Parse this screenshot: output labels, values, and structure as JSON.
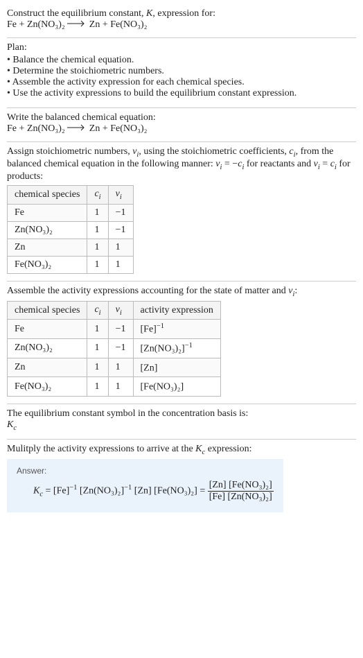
{
  "intro": {
    "line1_prefix": "Construct the equilibrium constant, ",
    "line1_K": "K",
    "line1_suffix": ", expression for:",
    "eqn_lhs": "Fe + Zn(NO₃)₂",
    "eqn_rhs": "Zn + Fe(NO₃)₂"
  },
  "plan": {
    "title": "Plan:",
    "items": [
      "Balance the chemical equation.",
      "Determine the stoichiometric numbers.",
      "Assemble the activity expression for each chemical species.",
      "Use the activity expressions to build the equilibrium constant expression."
    ]
  },
  "balanced": {
    "title": "Write the balanced chemical equation:",
    "eqn_lhs": "Fe + Zn(NO₃)₂",
    "eqn_rhs": "Zn + Fe(NO₃)₂"
  },
  "assign": {
    "text_parts": {
      "p1": "Assign stoichiometric numbers, ",
      "nu": "ν",
      "sub_i": "i",
      "p2": ", using the stoichiometric coefficients, ",
      "c": "c",
      "p3": ", from the balanced chemical equation in the following manner: ",
      "rel1": "ν",
      "rel1b": " = −",
      "rel1c": "c",
      "p4": " for reactants and ",
      "rel2": "ν",
      "rel2b": " = ",
      "rel2c": "c",
      "p5": " for products:"
    },
    "headers": {
      "species": "chemical species",
      "c": "c",
      "nu": "ν",
      "sub": "i"
    },
    "rows": [
      {
        "species": "Fe",
        "c": "1",
        "nu": "−1"
      },
      {
        "species": "Zn(NO₃)₂",
        "c": "1",
        "nu": "−1"
      },
      {
        "species": "Zn",
        "c": "1",
        "nu": "1"
      },
      {
        "species": "Fe(NO₃)₂",
        "c": "1",
        "nu": "1"
      }
    ]
  },
  "activity": {
    "text_prefix": "Assemble the activity expressions accounting for the state of matter and ",
    "nu": "ν",
    "sub_i": "i",
    "text_suffix": ":",
    "headers": {
      "species": "chemical species",
      "c": "c",
      "nu": "ν",
      "sub": "i",
      "act": "activity expression"
    },
    "rows": [
      {
        "species": "Fe",
        "c": "1",
        "nu": "−1",
        "act_base": "[Fe]",
        "act_exp": "−1"
      },
      {
        "species": "Zn(NO₃)₂",
        "c": "1",
        "nu": "−1",
        "act_base": "[Zn(NO₃)₂]",
        "act_exp": "−1"
      },
      {
        "species": "Zn",
        "c": "1",
        "nu": "1",
        "act_base": "[Zn]",
        "act_exp": ""
      },
      {
        "species": "Fe(NO₃)₂",
        "c": "1",
        "nu": "1",
        "act_base": "[Fe(NO₃)₂]",
        "act_exp": ""
      }
    ]
  },
  "basis": {
    "text": "The equilibrium constant symbol in the concentration basis is:",
    "symbol_K": "K",
    "symbol_sub": "c"
  },
  "multiply": {
    "text_prefix": "Mulitply the activity expressions to arrive at the ",
    "K": "K",
    "sub": "c",
    "text_suffix": " expression:"
  },
  "answer": {
    "label": "Answer:",
    "lhs_K": "K",
    "lhs_sub": "c",
    "eq": " = ",
    "term1_base": "[Fe]",
    "term1_exp": "−1",
    "term2_base": "[Zn(NO₃)₂]",
    "term2_exp": "−1",
    "term3": "[Zn]",
    "term4": "[Fe(NO₃)₂]",
    "eq2": " = ",
    "frac_num": "[Zn] [Fe(NO₃)₂]",
    "frac_den": "[Fe] [Zn(NO₃)₂]"
  },
  "chart_data": {
    "type": "table",
    "tables": [
      {
        "title": "Stoichiometric numbers",
        "columns": [
          "chemical species",
          "c_i",
          "nu_i"
        ],
        "rows": [
          [
            "Fe",
            1,
            -1
          ],
          [
            "Zn(NO3)2",
            1,
            -1
          ],
          [
            "Zn",
            1,
            1
          ],
          [
            "Fe(NO3)2",
            1,
            1
          ]
        ]
      },
      {
        "title": "Activity expressions",
        "columns": [
          "chemical species",
          "c_i",
          "nu_i",
          "activity expression"
        ],
        "rows": [
          [
            "Fe",
            1,
            -1,
            "[Fe]^-1"
          ],
          [
            "Zn(NO3)2",
            1,
            -1,
            "[Zn(NO3)2]^-1"
          ],
          [
            "Zn",
            1,
            1,
            "[Zn]"
          ],
          [
            "Fe(NO3)2",
            1,
            1,
            "[Fe(NO3)2]"
          ]
        ]
      }
    ]
  }
}
